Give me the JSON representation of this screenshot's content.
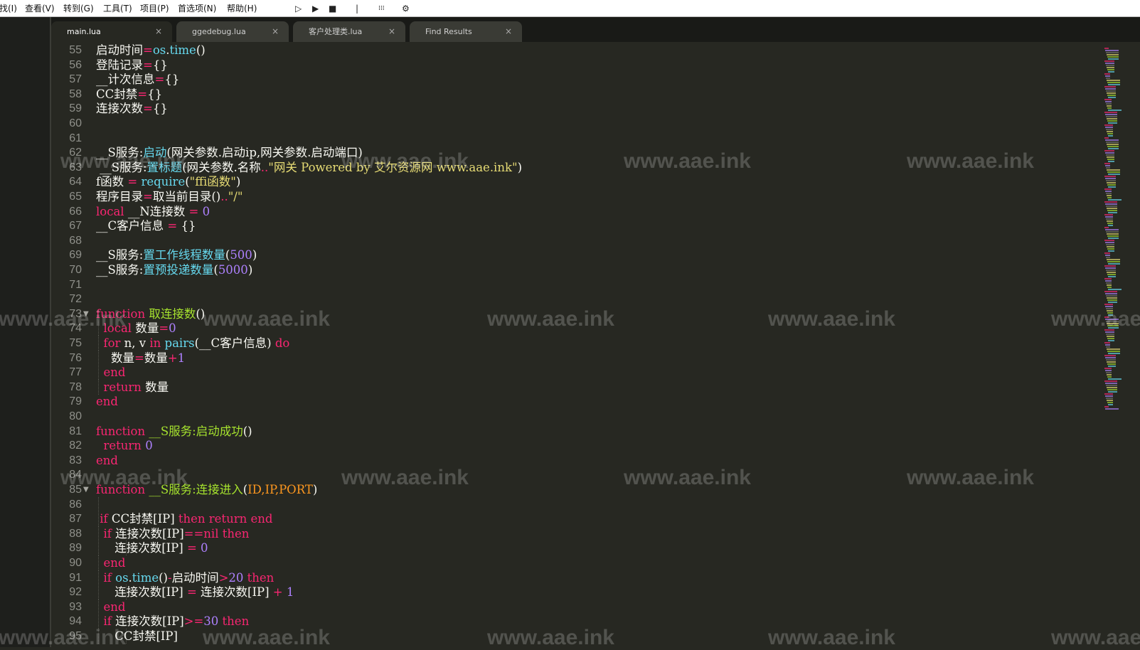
{
  "menu": {
    "items": [
      "找(I)",
      "查看(V)",
      "转到(G)",
      "工具(T)",
      "项目(P)",
      "首选项(N)",
      "帮助(H)"
    ],
    "toolbar_icons": [
      "run-outline-icon",
      "run-icon",
      "stop-icon",
      "separator-icon",
      "columns-icon",
      "gear-icon"
    ]
  },
  "tabs": [
    {
      "label": "main.lua",
      "active": true
    },
    {
      "label": "ggedebug.lua",
      "active": false
    },
    {
      "label": "客户处理类.lua",
      "active": false
    },
    {
      "label": "Find Results",
      "active": false
    }
  ],
  "tab_close_glyph": "×",
  "watermark": "www.aae.ink",
  "fold_glyph": "▼",
  "editor": {
    "lines": [
      {
        "n": "55",
        "text": "启动时间=os.time()"
      },
      {
        "n": "56",
        "text": "登陆记录={}"
      },
      {
        "n": "57",
        "text": "__计次信息={}"
      },
      {
        "n": "58",
        "text": "CC封禁={}"
      },
      {
        "n": "59",
        "text": "连接次数={}"
      },
      {
        "n": "60",
        "text": ""
      },
      {
        "n": "61",
        "text": ""
      },
      {
        "n": "62",
        "text": "__S服务:启动(网关参数.启动ip,网关参数.启动端口)"
      },
      {
        "n": "63",
        "text": " __S服务:置标题(网关参数.名称..\"网关 Powered by 艾尔资源网 www.aae.ink\")"
      },
      {
        "n": "64",
        "text": "f函数 = require(\"ffi函数\")"
      },
      {
        "n": "65",
        "text": "程序目录=取当前目录()..\"/\""
      },
      {
        "n": "66",
        "text": "local __N连接数 = 0"
      },
      {
        "n": "67",
        "text": "__C客户信息 = {}"
      },
      {
        "n": "68",
        "text": ""
      },
      {
        "n": "69",
        "text": "__S服务:置工作线程数量(500)"
      },
      {
        "n": "70",
        "text": "__S服务:置预投递数量(5000)"
      },
      {
        "n": "71",
        "text": ""
      },
      {
        "n": "72",
        "text": ""
      },
      {
        "n": "73",
        "text": "function 取连接数()",
        "fold": true
      },
      {
        "n": "74",
        "text": "  local 数量=0"
      },
      {
        "n": "75",
        "text": "  for n, v in pairs(__C客户信息) do"
      },
      {
        "n": "76",
        "text": "    数量=数量+1"
      },
      {
        "n": "77",
        "text": "  end"
      },
      {
        "n": "78",
        "text": "  return 数量"
      },
      {
        "n": "79",
        "text": "end"
      },
      {
        "n": "80",
        "text": ""
      },
      {
        "n": "81",
        "text": "function __S服务:启动成功()"
      },
      {
        "n": "82",
        "text": "  return 0"
      },
      {
        "n": "83",
        "text": "end"
      },
      {
        "n": "84",
        "text": ""
      },
      {
        "n": "85",
        "text": "function __S服务:连接进入(ID,IP,PORT)",
        "fold": true
      },
      {
        "n": "86",
        "text": ""
      },
      {
        "n": "87",
        "text": " if CC封禁[IP] then return end"
      },
      {
        "n": "88",
        "text": "  if 连接次数[IP]==nil then"
      },
      {
        "n": "89",
        "text": "     连接次数[IP] = 0"
      },
      {
        "n": "90",
        "text": "  end"
      },
      {
        "n": "91",
        "text": "  if os.time()-启动时间>20 then"
      },
      {
        "n": "92",
        "text": "     连接次数[IP] = 连接次数[IP] + 1"
      },
      {
        "n": "93",
        "text": "  end"
      },
      {
        "n": "94",
        "text": "  if 连接次数[IP]>=30 then"
      },
      {
        "n": "95",
        "text": "     CC封禁[IP]"
      }
    ]
  },
  "colors": {
    "background": "#272822",
    "keyword": "#f92672",
    "builtin": "#66d9ef",
    "number": "#ae81ff",
    "string": "#e6db74",
    "function_name": "#a6e22e",
    "parameter": "#fd971f",
    "line_number": "#8f908a"
  }
}
